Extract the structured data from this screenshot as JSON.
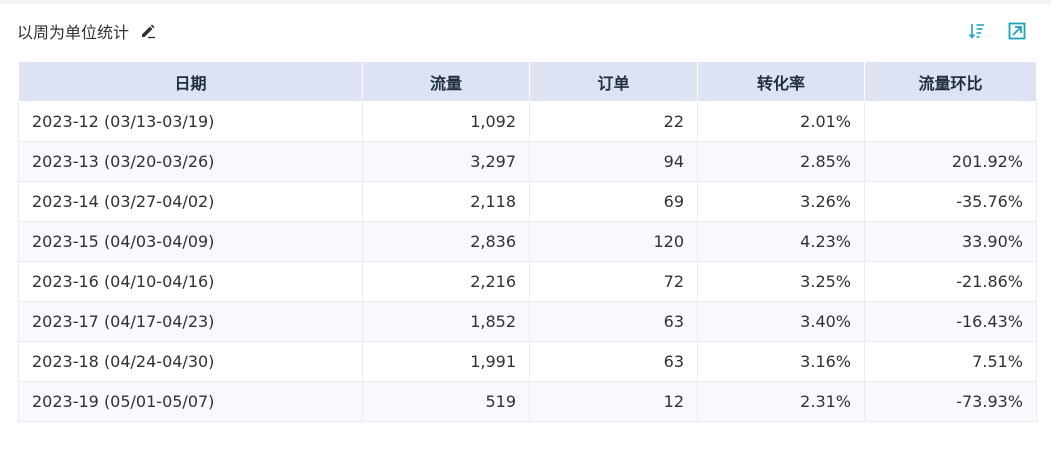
{
  "header": {
    "title": "以周为单位统计"
  },
  "icons": {
    "edit": "edit-icon",
    "sort": "sort-icon",
    "expand": "expand-icon",
    "accent_color": "#1aa2b8"
  },
  "table": {
    "columns": [
      "日期",
      "流量",
      "订单",
      "转化率",
      "流量环比"
    ],
    "rows": [
      [
        "2023-12 (03/13-03/19)",
        "1,092",
        "22",
        "2.01%",
        ""
      ],
      [
        "2023-13 (03/20-03/26)",
        "3,297",
        "94",
        "2.85%",
        "201.92%"
      ],
      [
        "2023-14 (03/27-04/02)",
        "2,118",
        "69",
        "3.26%",
        "-35.76%"
      ],
      [
        "2023-15 (04/03-04/09)",
        "2,836",
        "120",
        "4.23%",
        "33.90%"
      ],
      [
        "2023-16 (04/10-04/16)",
        "2,216",
        "72",
        "3.25%",
        "-21.86%"
      ],
      [
        "2023-17 (04/17-04/23)",
        "1,852",
        "63",
        "3.40%",
        "-16.43%"
      ],
      [
        "2023-18 (04/24-04/30)",
        "1,991",
        "63",
        "3.16%",
        "7.51%"
      ],
      [
        "2023-19 (05/01-05/07)",
        "519",
        "12",
        "2.31%",
        "-73.93%"
      ]
    ]
  }
}
